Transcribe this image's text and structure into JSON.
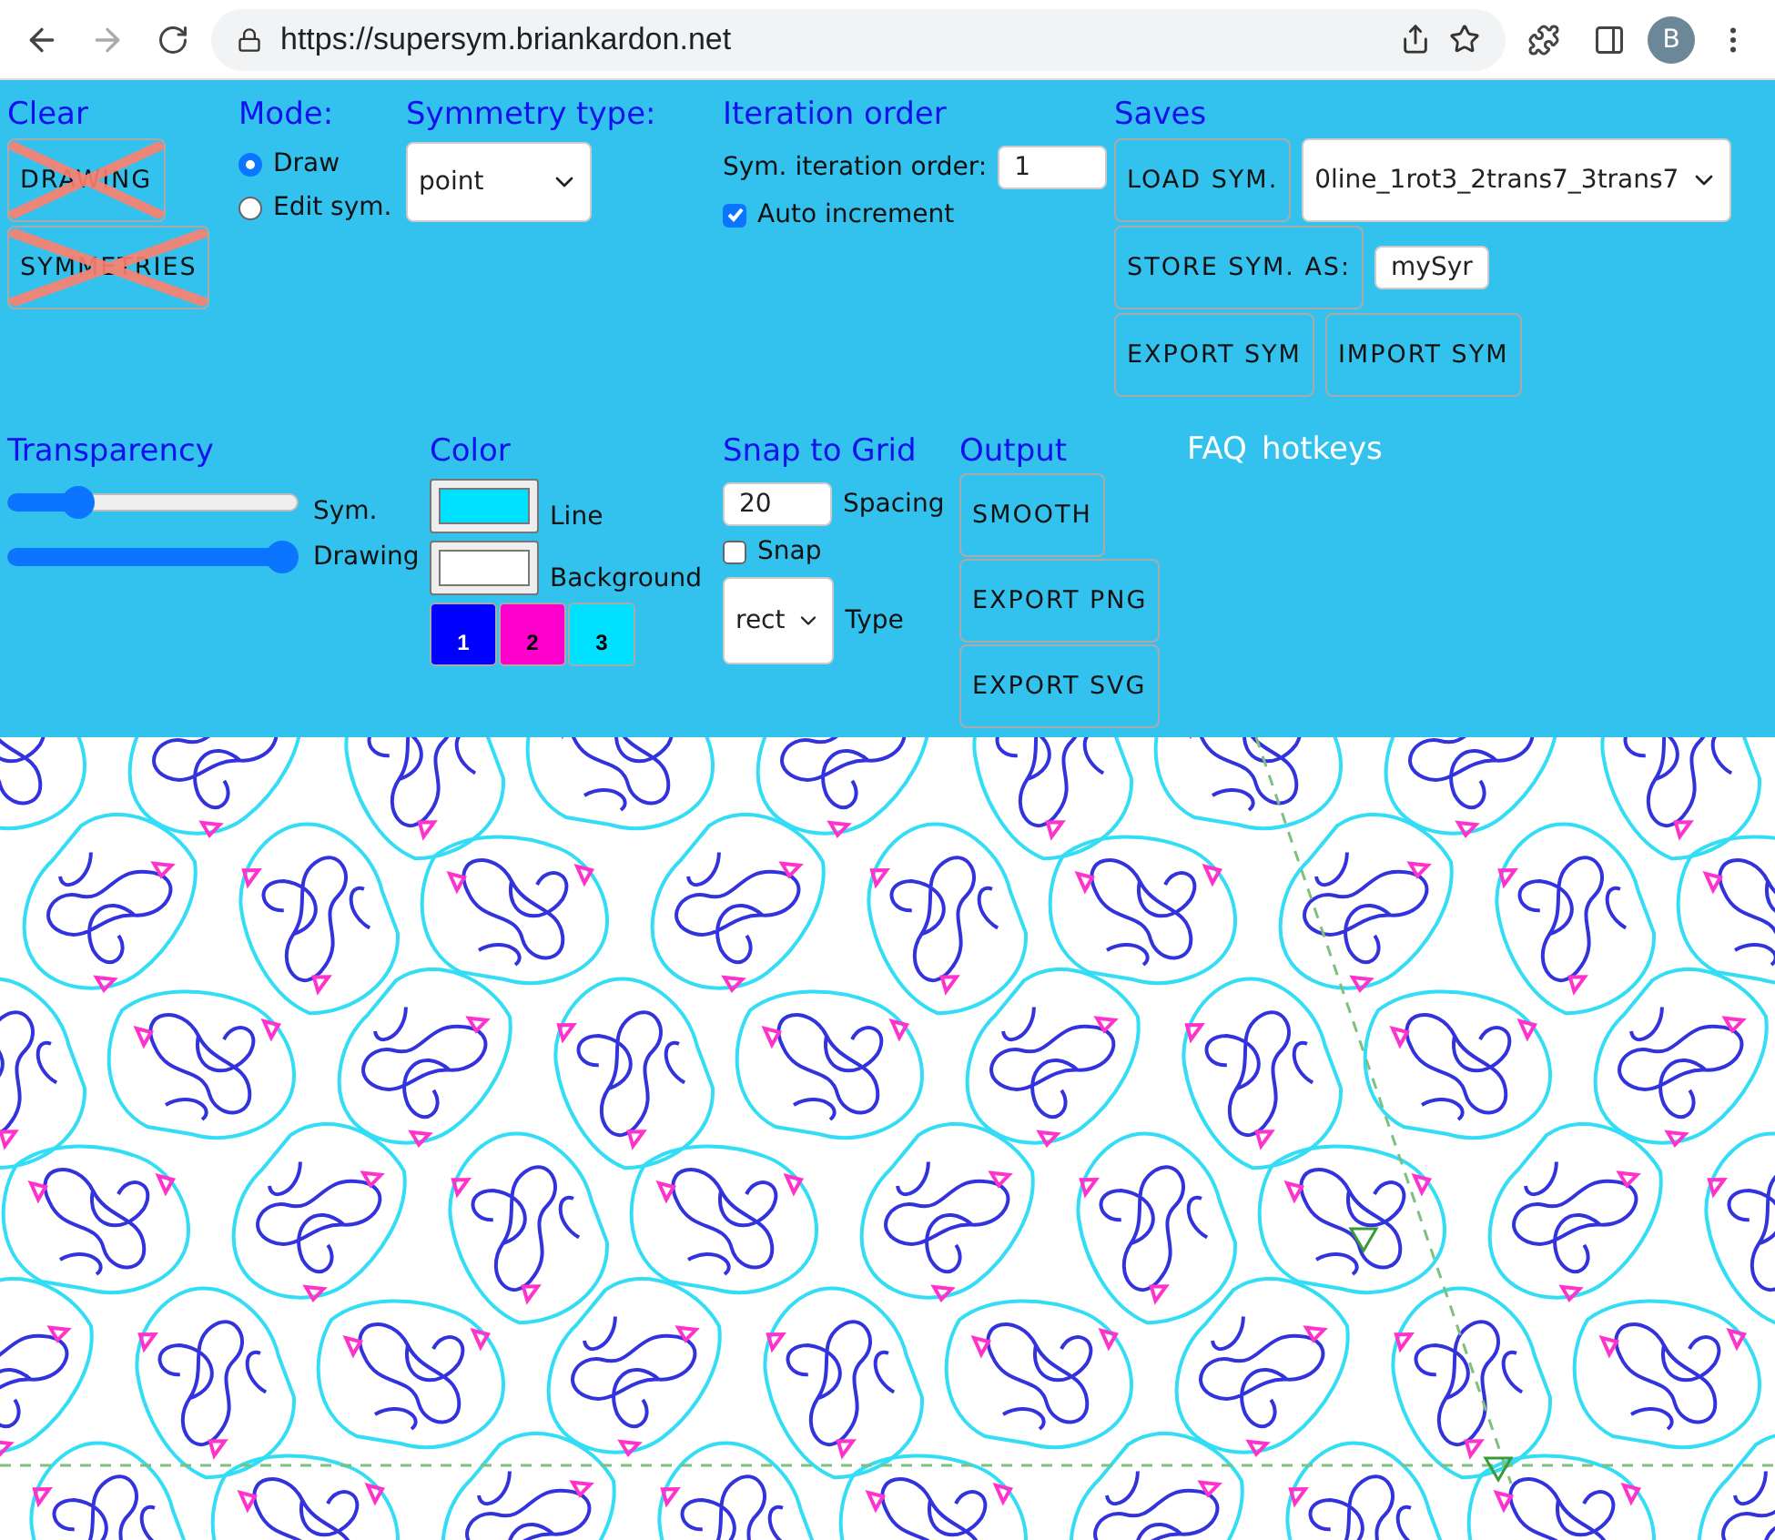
{
  "browser": {
    "url": "https://supersym.briankardon.net",
    "avatar": "B"
  },
  "clear": {
    "title": "Clear",
    "buttons": [
      "DRAWING",
      "SYMMETRIES"
    ]
  },
  "mode": {
    "title": "Mode:",
    "options": [
      {
        "label": "Draw",
        "selected": true
      },
      {
        "label": "Edit sym.",
        "selected": false
      }
    ]
  },
  "symmetry_type": {
    "title": "Symmetry type:",
    "value": "point"
  },
  "iteration_order": {
    "title": "Iteration order",
    "label": "Sym. iteration order:",
    "value": "1",
    "auto_increment": {
      "label": "Auto increment",
      "checked": true
    }
  },
  "saves": {
    "title": "Saves",
    "load_button": "LOAD SYM.",
    "load_value": "0line_1rot3_2trans7_3trans7",
    "store_button": "STORE SYM. AS:",
    "store_value": "mySyr",
    "export_button": "EXPORT SYM",
    "import_button": "IMPORT SYM"
  },
  "transparency": {
    "title": "Transparency",
    "sliders": [
      {
        "label": "Sym.",
        "level": 0.3
      },
      {
        "label": "Drawing",
        "level": 1.0
      }
    ]
  },
  "color": {
    "title": "Color",
    "swatches": [
      {
        "label": "Line",
        "color": "#00e1ff"
      },
      {
        "label": "Background",
        "color": "#ffffff"
      }
    ],
    "palette": [
      {
        "label": "1",
        "color": "#0000ff"
      },
      {
        "label": "2",
        "color": "#ff00cc"
      },
      {
        "label": "3",
        "color": "#00e1ff"
      }
    ]
  },
  "snap_to_grid": {
    "title": "Snap to Grid",
    "spacing_value": "20",
    "spacing_label": "Spacing",
    "snap": {
      "label": "Snap",
      "checked": false
    },
    "type_value": "rect",
    "type_label": "Type"
  },
  "output": {
    "title": "Output",
    "buttons": [
      "SMOOTH",
      "EXPORT PNG",
      "EXPORT SVG"
    ]
  },
  "links": [
    "FAQ",
    "hotkeys"
  ]
}
